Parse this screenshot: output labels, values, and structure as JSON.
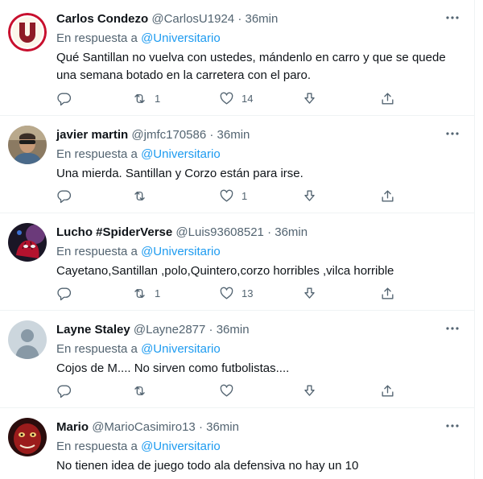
{
  "reply_prefix": "En respuesta a",
  "tweets": [
    {
      "name": "Carlos Condezo",
      "handle": "@CarlosU1924",
      "dot": "·",
      "time": "36min",
      "reply_to": "@Universitario",
      "text": "Qué Santillan no vuelva con ustedes, mándenlo en carro y que se quede una semana botado en la carretera con el paro.",
      "replies": "",
      "retweets": "1",
      "likes": "14",
      "avatar_icon": "universitario-logo"
    },
    {
      "name": "javier martin",
      "handle": "@jmfc170586",
      "dot": "·",
      "time": "36min",
      "reply_to": "@Universitario",
      "text": "Una mierda. Santillan y Corzo están para irse.",
      "replies": "",
      "retweets": "",
      "likes": "1",
      "avatar_icon": "user-photo"
    },
    {
      "name": "Lucho #SpiderVerse",
      "handle": "@Luis93608521",
      "dot": "·",
      "time": "36min",
      "reply_to": "@Universitario",
      "text": "Cayetano,Santillan ,polo,Quintero,corzo horribles ,vilca horrible",
      "replies": "",
      "retweets": "1",
      "likes": "13",
      "avatar_icon": "spiderman-avatar"
    },
    {
      "name": "Layne Staley",
      "handle": "@Layne2877",
      "dot": "·",
      "time": "36min",
      "reply_to": "@Universitario",
      "text": "Cojos de M.... No sirven como futbolistas....",
      "replies": "",
      "retweets": "",
      "likes": "",
      "avatar_icon": "default-user-avatar"
    },
    {
      "name": "Mario",
      "handle": "@MarioCasimiro13",
      "dot": "·",
      "time": "36min",
      "reply_to": "@Universitario",
      "text": "No tienen idea de juego todo ala defensiva no hay un 10",
      "replies": "",
      "retweets": "",
      "likes": "",
      "avatar_icon": "red-creature-avatar"
    }
  ]
}
